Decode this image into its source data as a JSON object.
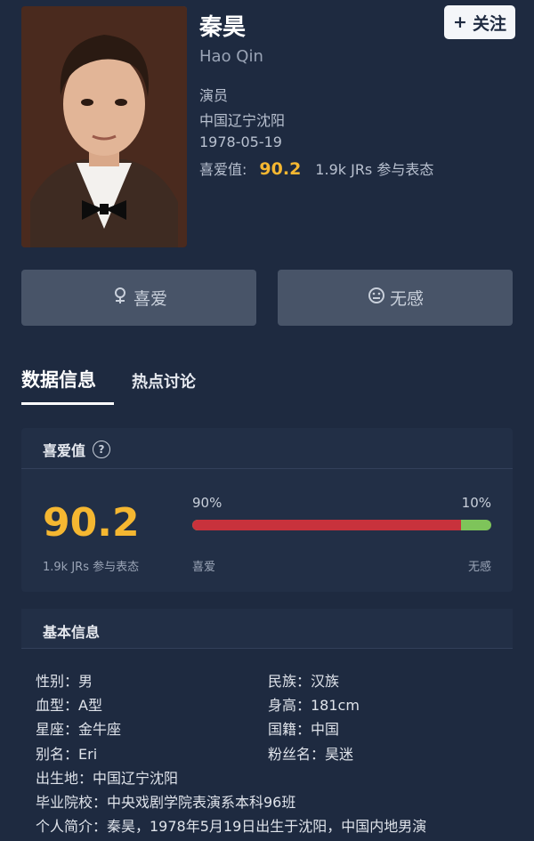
{
  "profile": {
    "name": "秦昊",
    "pinyin": "Hao Qin",
    "occupation": "演员",
    "birthplace": "中国辽宁沈阳",
    "birthdate": "1978-05-19",
    "love_label": "喜爱值:",
    "love_score": "90.2",
    "participants": "1.9k JRs 参与表态",
    "photo_icon": "person-portrait"
  },
  "actions": {
    "follow_label": "关注",
    "like_label": "喜爱",
    "indifferent_label": "无感"
  },
  "tabs": [
    {
      "label": "数据信息",
      "active": true
    },
    {
      "label": "热点讨论",
      "active": false
    }
  ],
  "love_card": {
    "title": "喜爱值",
    "score": "90.2",
    "participants": "1.9k JRs 参与表态",
    "like_percent_text": "90%",
    "dislike_percent_text": "10%",
    "like_fraction": 0.9,
    "like_label": "喜爱",
    "dislike_label": "无感",
    "like_color": "#c8323c",
    "dislike_color": "#7ec45a"
  },
  "basic_info": {
    "title": "基本信息",
    "gender": "性别：男",
    "ethnicity": "民族：汉族",
    "blood_type": "血型：A型",
    "height": "身高：181cm",
    "zodiac": "星座：金牛座",
    "nationality": "国籍：中国",
    "alias": "别名：Eri",
    "fan_name": "粉丝名：昊迷",
    "birthplace": "出生地：中国辽宁沈阳",
    "school": "毕业院校：中央戏剧学院表演系本科96班",
    "intro": "个人简介：秦昊，1978年5月19日出生于沈阳，中国内地男演"
  },
  "colors": {
    "background": "#1e2a40",
    "accent": "#f5b731",
    "button": "#485468"
  }
}
